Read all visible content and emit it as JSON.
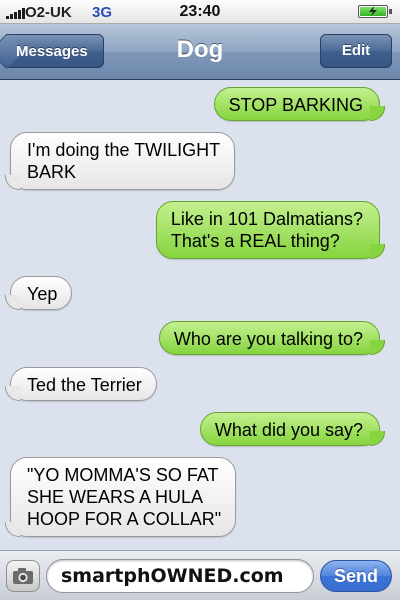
{
  "status_bar": {
    "carrier": "O2-UK",
    "network": "3G",
    "time": "23:40",
    "signal_bars": 5,
    "battery_charging": true
  },
  "nav_bar": {
    "back_label": "Messages",
    "title": "Dog",
    "edit_label": "Edit"
  },
  "messages": [
    {
      "sender": "me",
      "lines": [
        "STOP BARKING"
      ]
    },
    {
      "sender": "them",
      "lines": [
        "I'm doing the TWILIGHT",
        "BARK"
      ]
    },
    {
      "sender": "me",
      "lines": [
        "Like in 101 Dalmatians?",
        "That's a REAL thing?"
      ]
    },
    {
      "sender": "them",
      "lines": [
        "Yep"
      ]
    },
    {
      "sender": "me",
      "lines": [
        "Who are you talking to?"
      ]
    },
    {
      "sender": "them",
      "lines": [
        "Ted the Terrier"
      ]
    },
    {
      "sender": "me",
      "lines": [
        "What did you say?"
      ]
    },
    {
      "sender": "them",
      "lines": [
        "\"YO MOMMA'S SO FAT",
        "SHE WEARS A HULA",
        "HOOP FOR A COLLAR\""
      ]
    }
  ],
  "input_bar": {
    "text_value": "smartphOWNED.com",
    "send_label": "Send"
  },
  "colors": {
    "outgoing_bubble": "#8fd84a",
    "incoming_bubble": "#f2f2f2",
    "nav_bar": "#6d87ad",
    "background": "#dbe2ed",
    "send_button": "#3c73d6"
  },
  "icons": {
    "camera": "camera-icon",
    "battery": "battery-charging-icon",
    "signal": "signal-bars-icon"
  }
}
